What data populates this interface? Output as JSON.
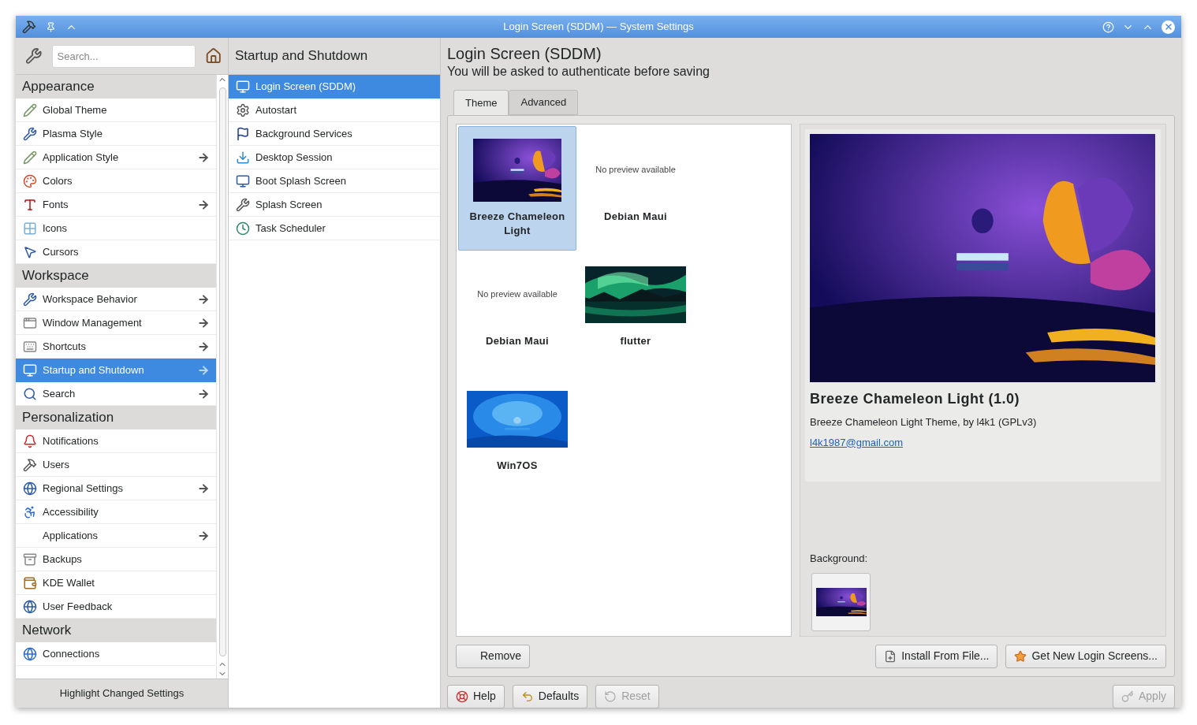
{
  "window": {
    "title": "Login Screen (SDDM) — System Settings"
  },
  "sidebar": {
    "search": {
      "placeholder": "Search..."
    },
    "sections": [
      {
        "title": "Appearance",
        "items": [
          {
            "label": "Global Theme",
            "has_children": false,
            "selected": false
          },
          {
            "label": "Plasma Style",
            "has_children": false,
            "selected": false
          },
          {
            "label": "Application Style",
            "has_children": true,
            "selected": false
          },
          {
            "label": "Colors",
            "has_children": false,
            "selected": false
          },
          {
            "label": "Fonts",
            "has_children": true,
            "selected": false
          },
          {
            "label": "Icons",
            "has_children": false,
            "selected": false
          },
          {
            "label": "Cursors",
            "has_children": false,
            "selected": false
          }
        ]
      },
      {
        "title": "Workspace",
        "items": [
          {
            "label": "Workspace Behavior",
            "has_children": true,
            "selected": false
          },
          {
            "label": "Window Management",
            "has_children": true,
            "selected": false
          },
          {
            "label": "Shortcuts",
            "has_children": true,
            "selected": false
          },
          {
            "label": "Startup and Shutdown",
            "has_children": true,
            "selected": true
          },
          {
            "label": "Search",
            "has_children": true,
            "selected": false
          }
        ]
      },
      {
        "title": "Personalization",
        "items": [
          {
            "label": "Notifications",
            "has_children": false,
            "selected": false
          },
          {
            "label": "Users",
            "has_children": false,
            "selected": false
          },
          {
            "label": "Regional Settings",
            "has_children": true,
            "selected": false
          },
          {
            "label": "Accessibility",
            "has_children": false,
            "selected": false
          },
          {
            "label": "Applications",
            "has_children": true,
            "selected": false
          },
          {
            "label": "Backups",
            "has_children": false,
            "selected": false
          },
          {
            "label": "KDE Wallet",
            "has_children": false,
            "selected": false
          },
          {
            "label": "User Feedback",
            "has_children": false,
            "selected": false
          }
        ]
      },
      {
        "title": "Network",
        "items": [
          {
            "label": "Connections",
            "has_children": false,
            "selected": false
          }
        ]
      }
    ],
    "footer_button": "Highlight Changed Settings"
  },
  "subpanel": {
    "title": "Startup and Shutdown",
    "items": [
      {
        "label": "Login Screen (SDDM)",
        "selected": true
      },
      {
        "label": "Autostart",
        "selected": false
      },
      {
        "label": "Background Services",
        "selected": false
      },
      {
        "label": "Desktop Session",
        "selected": false
      },
      {
        "label": "Boot Splash Screen",
        "selected": false
      },
      {
        "label": "Splash Screen",
        "selected": false
      },
      {
        "label": "Task Scheduler",
        "selected": false
      }
    ]
  },
  "content": {
    "title": "Login Screen (SDDM)",
    "subtitle": "You will be asked to authenticate before saving",
    "tabs": [
      {
        "label": "Theme",
        "selected": true
      },
      {
        "label": "Advanced",
        "selected": false
      }
    ],
    "themes": [
      {
        "name": "Breeze Chameleon Light",
        "kind": "preview",
        "selected": true
      },
      {
        "name": "Debian Maui",
        "kind": "no_preview",
        "placeholder_text": "No preview available",
        "selected": false
      },
      {
        "name": "Debian Maui",
        "kind": "no_preview",
        "placeholder_text": "No preview available",
        "selected": false
      },
      {
        "name": "flutter",
        "kind": "preview",
        "selected": false
      },
      {
        "name": "Win7OS",
        "kind": "preview",
        "selected": false
      }
    ],
    "details": {
      "name": "Breeze Chameleon Light (1.0)",
      "description": "Breeze Chameleon Light Theme, by l4k1 (GPLv3)",
      "email": "l4k1987@gmail.com",
      "background_label": "Background:"
    },
    "panel_buttons": [
      {
        "label": "Remove"
      },
      {
        "label": "Install From File..."
      },
      {
        "label": "Get New Login Screens..."
      }
    ]
  },
  "footer_buttons": [
    {
      "label": "Help",
      "disabled": false
    },
    {
      "label": "Defaults",
      "disabled": false
    },
    {
      "label": "Reset",
      "disabled": true
    },
    {
      "label": "Apply",
      "disabled": true
    }
  ]
}
